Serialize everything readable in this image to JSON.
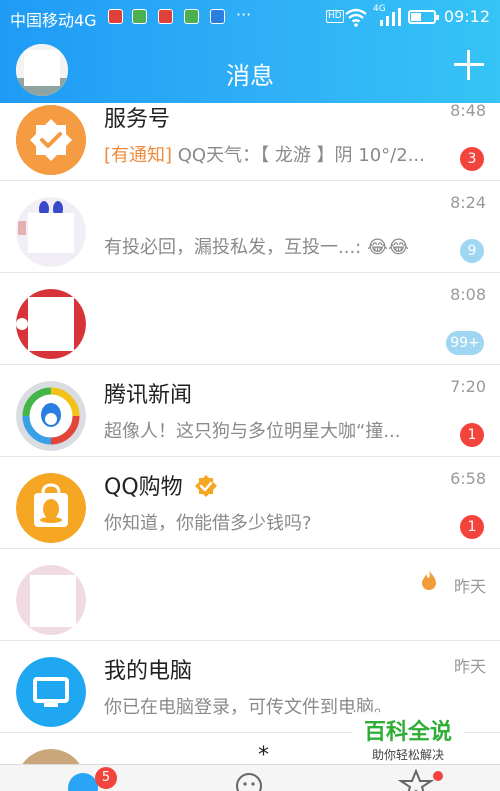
{
  "status_bar": {
    "carrier": "中国移动4G",
    "more": "···",
    "net": "4G",
    "hd": "HD",
    "time": "09:12"
  },
  "header": {
    "title": "消息"
  },
  "conversations": [
    {
      "name": "服务号",
      "tag": "[有通知]",
      "preview": " QQ天气：【 龙游 】阴 10°/2...",
      "time": "8:48",
      "badge": "3",
      "avatar_color": "#f59b42"
    },
    {
      "name": "",
      "tag": "",
      "preview": "有投必回，漏投私发，互投一...: 😂😂",
      "time": "8:24",
      "badge": "9",
      "avatar_color": "#e9e4f0"
    },
    {
      "name": "",
      "tag": "",
      "preview": "",
      "time": "8:08",
      "badge": "99+",
      "avatar_color": "#e8c6c6"
    },
    {
      "name": "腾讯新闻",
      "tag": "",
      "preview": "超像人！这只狗与多位明星大咖“撞...",
      "time": "7:20",
      "badge": "1",
      "avatar_color": "#d9dde2"
    },
    {
      "name": "QQ购物",
      "tag": "",
      "preview": "你知道，你能借多少钱吗?",
      "time": "6:58",
      "badge": "1",
      "avatar_color": "#f5a623"
    },
    {
      "name": "",
      "tag": "",
      "preview": "",
      "time": "昨天",
      "badge": "",
      "avatar_color": "#f0dbe3"
    },
    {
      "name": "我的电脑",
      "tag": "",
      "preview": "你已在电脑登录，可传文件到电脑。",
      "time": "昨天",
      "badge": "",
      "avatar_color": "#1fa8f1"
    },
    {
      "name": "*",
      "tag": "",
      "preview": "",
      "time": "",
      "badge": "",
      "avatar_color": "#c9a77a"
    }
  ],
  "bottom_nav": {
    "messages_badge": "5"
  },
  "watermark": {
    "title": "百科全说",
    "subtitle": "助你轻松解决"
  },
  "colors": {
    "header": "#1f9bf5",
    "badge_red": "#f2443c",
    "badge_muted": "#9fd6f2",
    "tag_orange": "#f08a3a"
  },
  "icons": [
    "wifi-icon",
    "signal-icon",
    "battery-icon",
    "plus-icon",
    "verified-icon",
    "fire-icon",
    "monitor-icon"
  ]
}
